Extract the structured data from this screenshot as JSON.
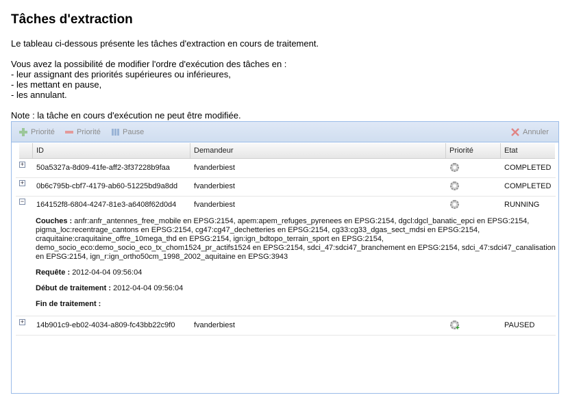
{
  "title": "Tâches d'extraction",
  "intro": {
    "line1": "Le tableau ci-dessous présente les tâches d'extraction en cours de traitement.",
    "line2": "Vous avez la possibilité de modifier l'ordre d'exécution des tâches en :",
    "line3": "- leur assignant des priorités supérieures ou inférieures,",
    "line4": "- les mettant en pause,",
    "line5": "- les annulant.",
    "note": "Note : la tâche en cours d'exécution ne peut être modifiée."
  },
  "toolbar": {
    "priority_up": "Priorité",
    "priority_down": "Priorité",
    "pause": "Pause",
    "cancel": "Annuler"
  },
  "columns": {
    "id": "ID",
    "requester": "Demandeur",
    "priority": "Priorité",
    "status": "Etat"
  },
  "rows": [
    {
      "expander": "+",
      "id": "50a5327a-8d09-41fe-aff2-3f37228b9faa",
      "requester": "fvanderbiest",
      "status": "COMPLETED"
    },
    {
      "expander": "+",
      "id": "0b6c795b-cbf7-4179-ab60-51225bd9a8dd",
      "requester": "fvanderbiest",
      "status": "COMPLETED"
    },
    {
      "expander": "−",
      "id": "164152f8-6804-4247-81e3-a6408f62d0d4",
      "requester": "fvanderbiest",
      "status": "RUNNING"
    },
    {
      "expander": "+",
      "id": "14b901c9-eb02-4034-a809-fc43bb22c9f0",
      "requester": "fvanderbiest",
      "status": "PAUSED"
    }
  ],
  "details": {
    "layers_label": "Couches :",
    "layers_value": "anfr:anfr_antennes_free_mobile en EPSG:2154, apem:apem_refuges_pyrenees en EPSG:2154, dgcl:dgcl_banatic_epci en EPSG:2154, pigma_loc:recentrage_cantons en EPSG:2154, cg47:cg47_dechetteries en EPSG:2154, cg33:cg33_dgas_sect_mdsi en EPSG:2154, craquitaine:craquitaine_offre_10mega_thd en EPSG:2154, ign:ign_bdtopo_terrain_sport en EPSG:2154, demo_socio_eco:demo_socio_eco_tx_chom1524_pr_actifs1524 en EPSG:2154, sdci_47:sdci47_branchement en EPSG:2154, sdci_47:sdci47_canalisation en EPSG:2154, ign_r:ign_ortho50cm_1998_2002_aquitaine en EPSG:3943",
    "request_label": "Requête :",
    "request_value": "2012-04-04 09:56:04",
    "start_label": "Début de traitement :",
    "start_value": "2012-04-04 09:56:04",
    "end_label": "Fin de traitement :",
    "end_value": ""
  }
}
